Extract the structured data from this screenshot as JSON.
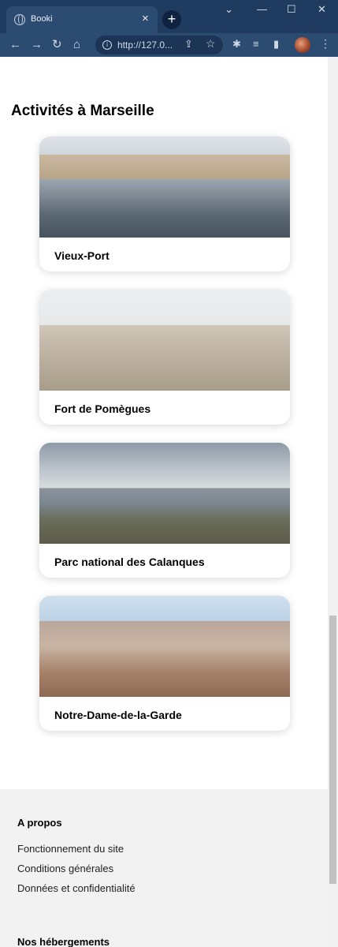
{
  "browser": {
    "tab_title": "Booki",
    "tab_close": "×",
    "new_tab": "+",
    "url": "http://127.0...",
    "window_controls": [
      "⌄",
      "—",
      "☐",
      "✕"
    ],
    "icons": [
      "globe-icon",
      "back-icon",
      "forward-icon",
      "reload-icon",
      "home-icon",
      "info-icon",
      "share-icon",
      "star-icon",
      "extensions-icon",
      "media-icon",
      "sidepanel-icon",
      "profile-avatar",
      "menu-icon"
    ]
  },
  "page": {
    "section_title": "Activités à Marseille",
    "activities": [
      {
        "label": "Vieux-Port"
      },
      {
        "label": "Fort de Pomègues"
      },
      {
        "label": "Parc national des Calanques"
      },
      {
        "label": "Notre-Dame-de-la-Garde"
      }
    ]
  },
  "footer": {
    "about_heading": "A propos",
    "about_links": [
      "Fonctionnement du site",
      "Conditions générales",
      "Données et confidentialité"
    ],
    "lodging_heading": "Nos hébergements"
  }
}
